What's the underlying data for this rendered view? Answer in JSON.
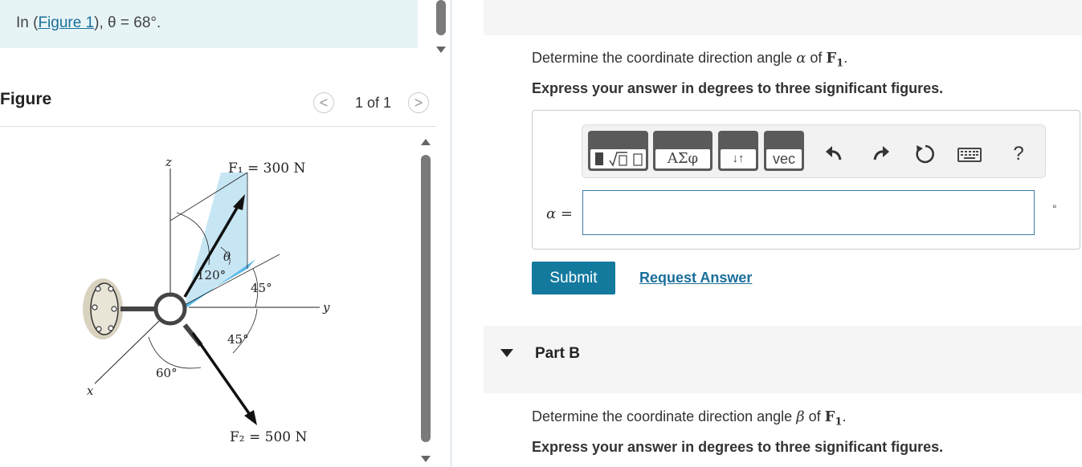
{
  "intro": {
    "prefix": "In (",
    "link": "Figure 1",
    "suffix": "), θ = 68°."
  },
  "figure": {
    "title": "Figure",
    "page_count": "1 of 1",
    "prev": "<",
    "next": ">",
    "labels": {
      "z": "z",
      "y": "y",
      "x": "x",
      "f1": "F₁ = 300 N",
      "f2": "F₂ = 500 N",
      "theta": "θ",
      "a120": "120°",
      "a45a": "45°",
      "a45b": "45°",
      "a60": "60°"
    }
  },
  "partA": {
    "q_prefix": "Determine the coordinate direction angle ",
    "q_var": "α",
    "q_mid": " of ",
    "q_force": "F",
    "q_sub": "1",
    "q_end": ".",
    "instruction": "Express your answer in degrees to three significant figures.",
    "toolbar": {
      "greek": "ΑΣφ",
      "arrows": "↓↑",
      "vec": "vec",
      "help": "?"
    },
    "var_label": "α =",
    "input_value": "",
    "unit": "°",
    "submit": "Submit",
    "request": "Request Answer"
  },
  "partB": {
    "label": "Part B",
    "q_prefix": "Determine the coordinate direction angle ",
    "q_var": "β",
    "q_mid": " of ",
    "q_force": "F",
    "q_sub": "1",
    "q_end": ".",
    "instruction": "Express your answer in degrees to three significant figures."
  },
  "colors": {
    "accent": "#137a9e",
    "link": "#1a6f9b",
    "intro_bg": "#e6f4f6",
    "figure_blue": "#5ab9e8"
  }
}
